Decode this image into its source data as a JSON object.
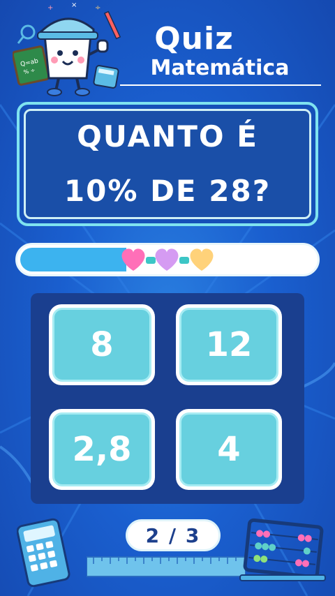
{
  "header": {
    "title_top": "Quiz",
    "title_bottom": "Matemática"
  },
  "question": {
    "line1": "QUANTO É",
    "line2": "10% DE 28?"
  },
  "progress": {
    "fraction": 0.36
  },
  "answers": [
    {
      "label": "8"
    },
    {
      "label": "12"
    },
    {
      "label": "2,8"
    },
    {
      "label": "4"
    }
  ],
  "counter": {
    "text": "2 / 3"
  },
  "colors": {
    "background": "#1a5fcf",
    "answer_fill": "#67d0df",
    "progress_fill": "#3cb3ef",
    "heart_pink": "#ff6fb8",
    "heart_purple": "#d59bf2",
    "heart_yellow": "#ffd27a"
  },
  "icons": [
    "mascot-icon",
    "heart-icon",
    "calculator-icon",
    "abacus-icon",
    "ruler-icon"
  ]
}
